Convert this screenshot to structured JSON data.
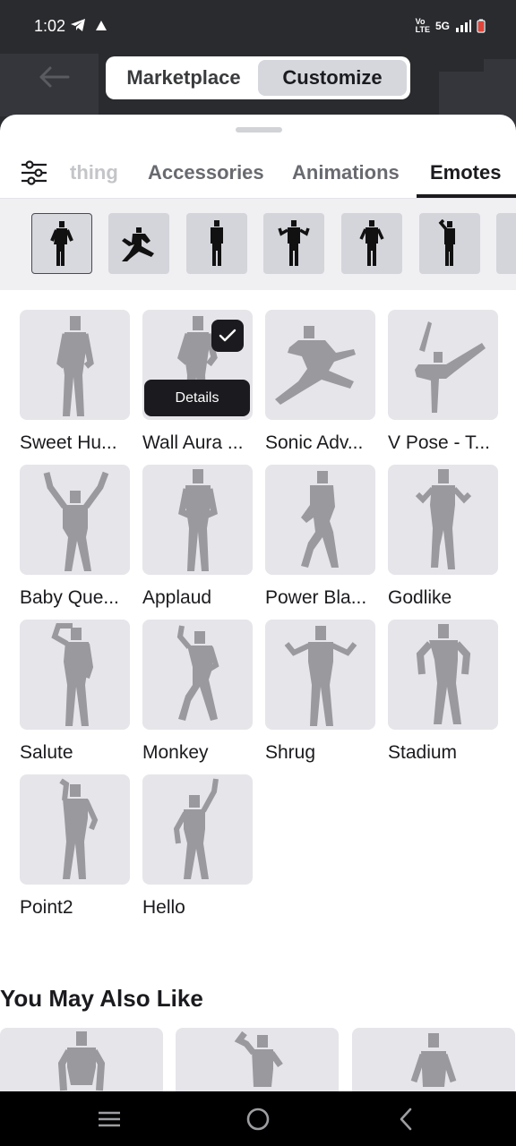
{
  "status": {
    "time": "1:02",
    "network": "5G"
  },
  "header": {
    "segments": [
      "Marketplace",
      "Customize"
    ],
    "active_segment": "Customize"
  },
  "tabs": {
    "items": [
      "thing",
      "Accessories",
      "Animations",
      "Emotes"
    ],
    "active": "Emotes"
  },
  "grid": {
    "items": [
      {
        "label": "Sweet Hu..."
      },
      {
        "label": "Wall Aura ...",
        "checked": true,
        "details": "Details"
      },
      {
        "label": "Sonic Adv..."
      },
      {
        "label": "V Pose - T..."
      },
      {
        "label": "Baby Que..."
      },
      {
        "label": "Applaud"
      },
      {
        "label": "Power Bla..."
      },
      {
        "label": "Godlike"
      },
      {
        "label": "Salute"
      },
      {
        "label": "Monkey"
      },
      {
        "label": "Shrug"
      },
      {
        "label": "Stadium"
      },
      {
        "label": "Point2"
      },
      {
        "label": "Hello"
      }
    ]
  },
  "recommendations": {
    "title": "You May Also Like"
  },
  "colors": {
    "accent": "#1b1b1f",
    "tile": "#e5e5ea",
    "figure": "#9a9a9e"
  },
  "icons": {
    "back": "arrow-left-icon",
    "filter": "sliders-icon",
    "check": "checkmark-icon",
    "nav": [
      "menu-icon",
      "home-icon",
      "back-icon"
    ]
  }
}
